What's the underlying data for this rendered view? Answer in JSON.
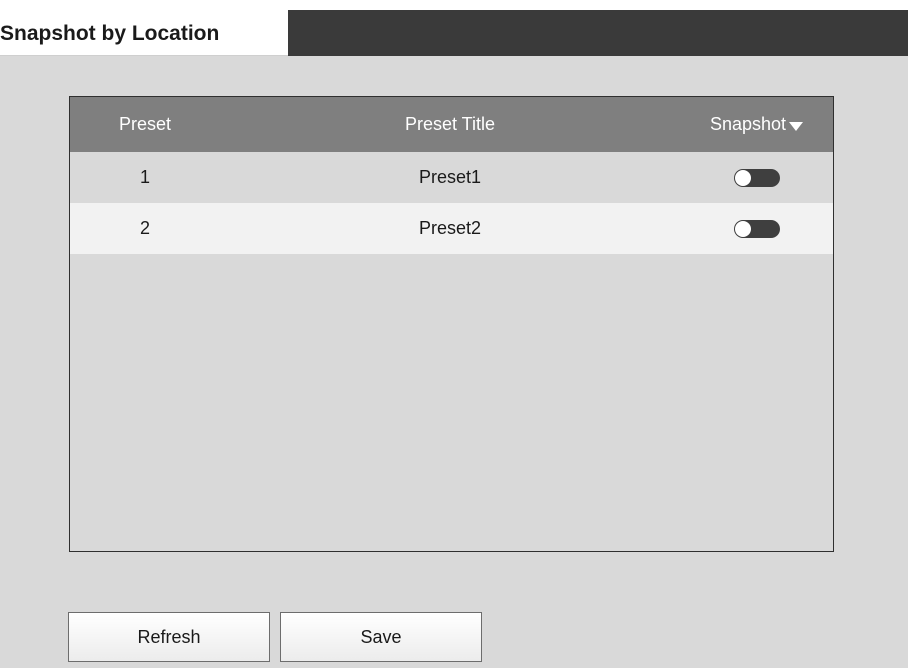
{
  "header": {
    "title": "Snapshot by Location"
  },
  "table": {
    "columns": {
      "preset": "Preset",
      "title": "Preset Title",
      "snapshot": "Snapshot"
    },
    "rows": [
      {
        "preset": "1",
        "title": "Preset1",
        "snapshot_on": false
      },
      {
        "preset": "2",
        "title": "Preset2",
        "snapshot_on": false
      }
    ]
  },
  "actions": {
    "refresh": "Refresh",
    "save": "Save"
  },
  "colors": {
    "header_bar": "#3a3a3a",
    "table_header": "#7f7f7f",
    "background": "#d9d9d9",
    "toggle_off": "#3f3f3f"
  },
  "icons": {
    "snapshot_sort": "caret-down-icon"
  }
}
